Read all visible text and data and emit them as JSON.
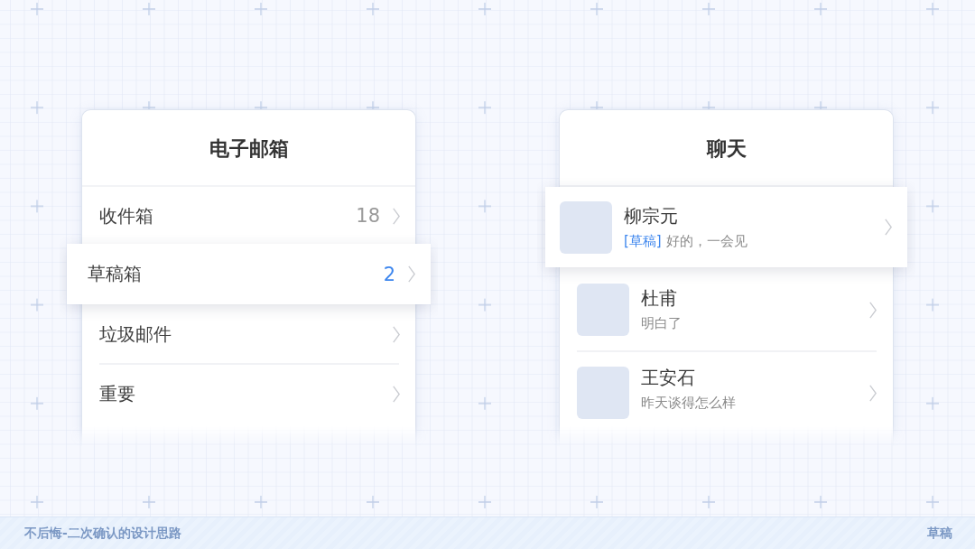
{
  "panels": [
    {
      "kind": "folders",
      "title": "电子邮箱",
      "items": [
        {
          "label": "收件箱",
          "count": "18",
          "selected": false
        },
        {
          "label": "草稿箱",
          "count": "2",
          "selected": true
        },
        {
          "label": "垃圾邮件",
          "selected": false
        },
        {
          "label": "重要",
          "selected": false
        }
      ]
    },
    {
      "kind": "chats",
      "title": "聊天",
      "items": [
        {
          "name": "柳宗元",
          "draft_tag": "[草稿]",
          "preview": "好的，一会见",
          "selected": true
        },
        {
          "name": "杜甫",
          "preview": "明白了",
          "selected": false
        },
        {
          "name": "王安石",
          "preview": "昨天谈得怎么样",
          "selected": false
        }
      ]
    }
  ],
  "footer": {
    "title": "不后悔-二次确认的设计思路",
    "label": "草稿"
  }
}
